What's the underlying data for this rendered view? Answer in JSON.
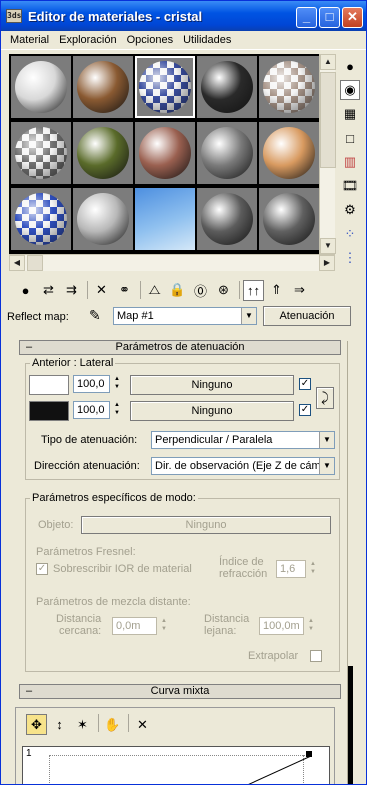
{
  "window": {
    "title": "Editor de materiales - cristal",
    "app_icon": "3ds-icon",
    "controls": [
      "_",
      "□",
      "✕"
    ]
  },
  "menu": [
    "Material",
    "Exploración",
    "Opciones",
    "Utilidades"
  ],
  "slots": [
    {
      "name": "white",
      "color": "#d8d8d8"
    },
    {
      "name": "brown",
      "color": "#8a5a32"
    },
    {
      "name": "checker-multicolor",
      "color": "#3a4ea0"
    },
    {
      "name": "black",
      "color": "#2a2a2a"
    },
    {
      "name": "checker-brown-white",
      "color": "#a9968a"
    },
    {
      "name": "checker-gray",
      "color": "#707070"
    },
    {
      "name": "green-moss",
      "color": "#5a6b2a"
    },
    {
      "name": "copper",
      "color": "#9a6050"
    },
    {
      "name": "gray-granite",
      "color": "#7a7a7a"
    },
    {
      "name": "skin",
      "color": "#d89a60"
    },
    {
      "name": "checker-blue-white",
      "color": "#3050c0"
    },
    {
      "name": "light-gray",
      "color": "#b8b8b8"
    },
    {
      "name": "sky",
      "color": "#6aa8e4"
    },
    {
      "name": "dark-gray",
      "color": "#5c5c5c"
    },
    {
      "name": "medium-gray",
      "color": "#606060"
    }
  ],
  "reflect": {
    "label": "Reflect map:",
    "value": "Map #1",
    "button": "Atenuación"
  },
  "atenuacion": {
    "rollout_title": "Parámetros de atenuación",
    "group_title": "Anterior : Lateral",
    "row1": {
      "value": "100,0",
      "button": "Ninguno"
    },
    "row2": {
      "value": "100,0",
      "button": "Ninguno"
    },
    "tipo_label": "Tipo de atenuación:",
    "tipo_value": "Perpendicular / Paralela",
    "dir_label": "Dirección atenuación:",
    "dir_value": "Dir. de observación (Eje Z de cám"
  },
  "modo": {
    "group_title": "Parámetros específicos de modo:",
    "objeto_label": "Objeto:",
    "objeto_button": "Ninguno",
    "fresnel_title": "Parámetros Fresnel:",
    "override_label": "Sobrescribir IOR de material",
    "indice_label": "Índice de\nrefracción",
    "indice_value": "1,6",
    "mezcla_title": "Parámetros de mezcla distante:",
    "cercana_label": "Distancia\ncercana:",
    "cercana_value": "0,0m",
    "lejana_label": "Distancia\nlejana:",
    "lejana_value": "100,0m",
    "extrapolar_label": "Extrapolar"
  },
  "curva": {
    "rollout_title": "Curva mixta",
    "graph_label": "1"
  }
}
